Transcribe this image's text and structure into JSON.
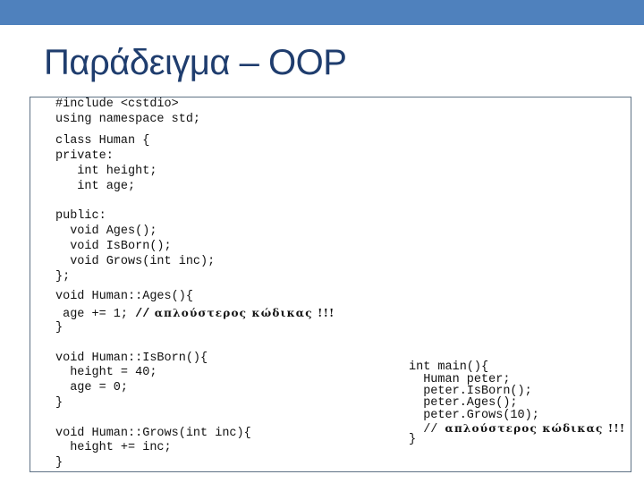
{
  "slide": {
    "title": "Παράδειγμα – OOP",
    "accent_color": "#4f81bd",
    "title_color": "#1f3d6e"
  },
  "code": {
    "left": [
      {
        "text": "#include <cstdio>"
      },
      {
        "text": "using namespace std;"
      },
      {
        "text": "class Human {"
      },
      {
        "text": "private:"
      },
      {
        "text": "   int height;"
      },
      {
        "text": "   int age;"
      },
      {
        "text": "public:"
      },
      {
        "text": "  void Ages();"
      },
      {
        "text": "  void IsBorn();"
      },
      {
        "text": "  void Grows(int inc);"
      },
      {
        "text": "};"
      },
      {
        "text": "void Human::Ages(){"
      },
      {
        "text": " age += 1; ",
        "slash": "//",
        "comment": " απλούστερος κώδικας !!!"
      },
      {
        "text": "}"
      },
      {
        "text": "void Human::IsBorn(){"
      },
      {
        "text": "  height = 40;"
      },
      {
        "text": "  age = 0;"
      },
      {
        "text": "}"
      },
      {
        "text": "void Human::Grows(int inc){"
      },
      {
        "text": "  height += inc;"
      },
      {
        "text": "}"
      }
    ],
    "right": [
      {
        "text": "int main(){"
      },
      {
        "text": "  Human peter;"
      },
      {
        "text": "  peter.IsBorn();"
      },
      {
        "text": "  peter.Ages();"
      },
      {
        "text": "  peter.Grows(10);"
      },
      {
        "text": "  // ",
        "comment": "απλούστερος κώδικας !!!"
      },
      {
        "text": "}"
      }
    ]
  }
}
